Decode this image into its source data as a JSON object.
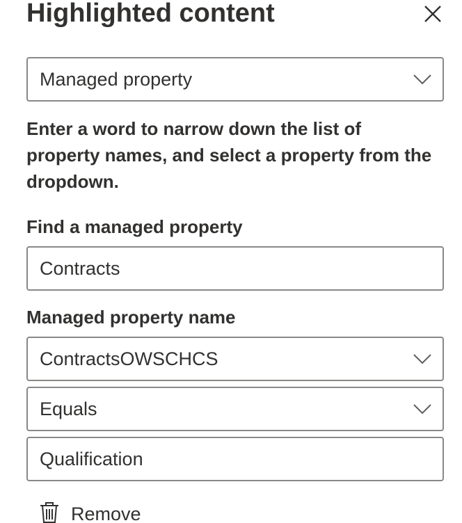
{
  "panel": {
    "title": "Highlighted content",
    "close_icon": "close-icon"
  },
  "source_dropdown": {
    "value": "Managed property",
    "icon": "chevron-down-icon"
  },
  "help_text": "Enter a word to narrow down the list of property names, and select a property from the dropdown.",
  "find_property": {
    "label": "Find a managed property",
    "value": "Contracts"
  },
  "property_name": {
    "label": "Managed property name",
    "value": "ContractsOWSCHCS",
    "icon": "chevron-down-icon"
  },
  "operator_dropdown": {
    "value": "Equals",
    "icon": "chevron-down-icon"
  },
  "filter_value": {
    "value": "Qualification"
  },
  "remove_action": {
    "label": "Remove",
    "icon": "trash-icon"
  },
  "colors": {
    "text": "#323130",
    "border": "#8a8886",
    "icon": "#605e5c"
  }
}
